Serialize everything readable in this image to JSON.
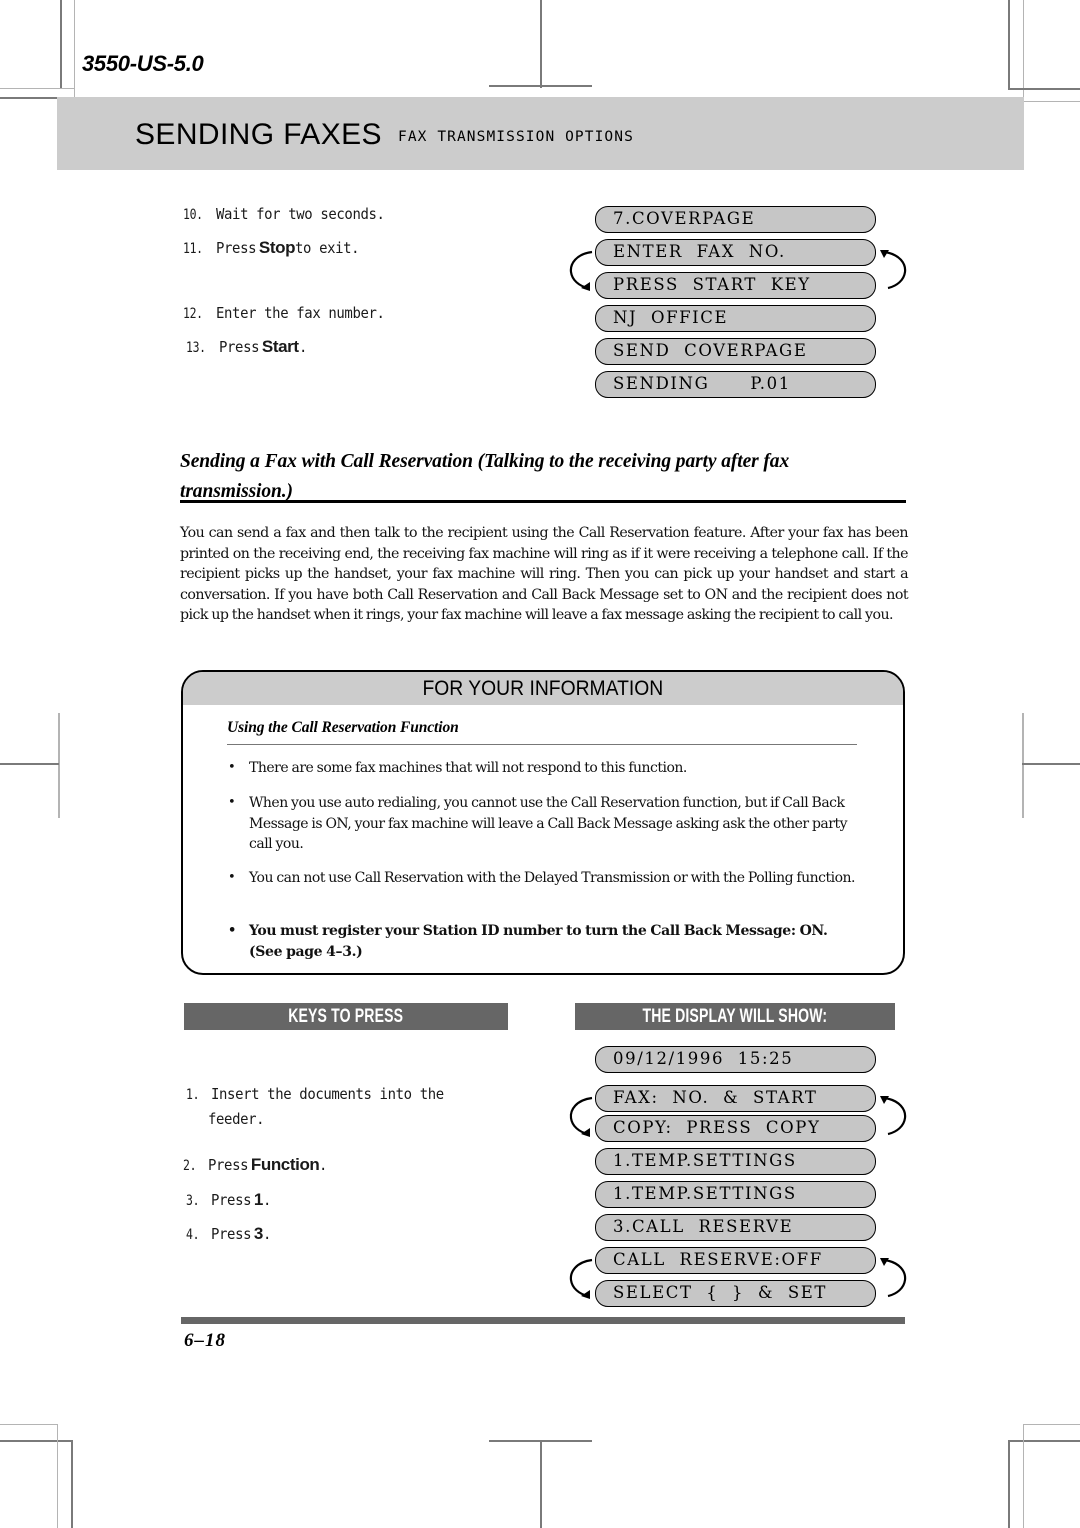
{
  "document": {
    "code": "3550-US-5.0",
    "page_number": "6–18"
  },
  "header": {
    "title": "SENDING FAXES",
    "subtitle": "FAX TRANSMISSION OPTIONS"
  },
  "top_steps": [
    {
      "num": "10.",
      "pre": "Wait for two seconds.",
      "key": "",
      "post": ""
    },
    {
      "num": "11.",
      "pre": "Press ",
      "key": "Stop",
      "post": " to exit."
    },
    {
      "num": "12.",
      "pre": "Enter the fax number.",
      "key": "",
      "post": ""
    },
    {
      "num": "13.",
      "pre": "Press ",
      "key": "Start",
      "post": "."
    }
  ],
  "top_displays": [
    "7.COVERPAGE",
    "ENTER  FAX  NO.",
    "PRESS  START  KEY",
    "NJ  OFFICE",
    "SEND  COVERPAGE",
    "SENDING      P.01"
  ],
  "section": {
    "heading": "Sending a Fax with Call Reservation (Talking to the receiving party after fax transmission.)",
    "paragraph": "You can send a fax and then talk to the recipient using the Call Reservation feature. After your fax has been printed on the receiving end, the receiving fax machine will ring as if it were receiving a telephone call. If the recipient picks up the handset, your fax machine will ring. Then you can pick up your handset and start a conversation. If you have both Call Reservation and Call Back Message set to ON and the recipient does not pick up the handset when it rings, your fax machine will leave a fax message asking the recipient to call you."
  },
  "fyi": {
    "title": "FOR YOUR INFORMATION",
    "subtitle": "Using the Call Reservation Function",
    "bullets": [
      {
        "text": "There are some fax machines that will not respond to this function.",
        "bold": false
      },
      {
        "text": "When you use auto redialing, you cannot use the Call Reservation function, but if Call Back Message is ON, your fax machine will leave a Call Back Message asking ask the other party call you.",
        "bold": false
      },
      {
        "text": "You can not use Call Reservation with the Delayed Transmission or with the Polling function.",
        "bold": false
      },
      {
        "text": "You must register your Station ID number to turn the Call Back Message: ON. (See page 4–3.)",
        "bold": true
      }
    ]
  },
  "columns": {
    "keys_label": "KEYS TO PRESS",
    "display_label": "THE DISPLAY WILL SHOW:"
  },
  "bottom_steps": [
    {
      "num": "1.",
      "pre": "Insert the documents into the",
      "key": "",
      "post": ""
    },
    {
      "num": "",
      "pre": "feeder.",
      "key": "",
      "post": ""
    },
    {
      "num": "2.",
      "pre": "Press ",
      "key": "Function",
      "post": "."
    },
    {
      "num": "3.",
      "pre": "Press ",
      "key": "1",
      "post": "."
    },
    {
      "num": "4.",
      "pre": "Press ",
      "key": "3",
      "post": "."
    }
  ],
  "bottom_displays": [
    "09/12/1996  15:25",
    "FAX:  NO.  &  START",
    "COPY:  PRESS  COPY",
    "1.TEMP.SETTINGS",
    "1.TEMP.SETTINGS",
    "3.CALL  RESERVE",
    "CALL  RESERVE:OFF",
    "SELECT  {  }  &  SET"
  ],
  "colors": {
    "band_gray": "#cccccc",
    "bar_gray": "#666666",
    "lcd_gray": "#c6c6c6"
  }
}
